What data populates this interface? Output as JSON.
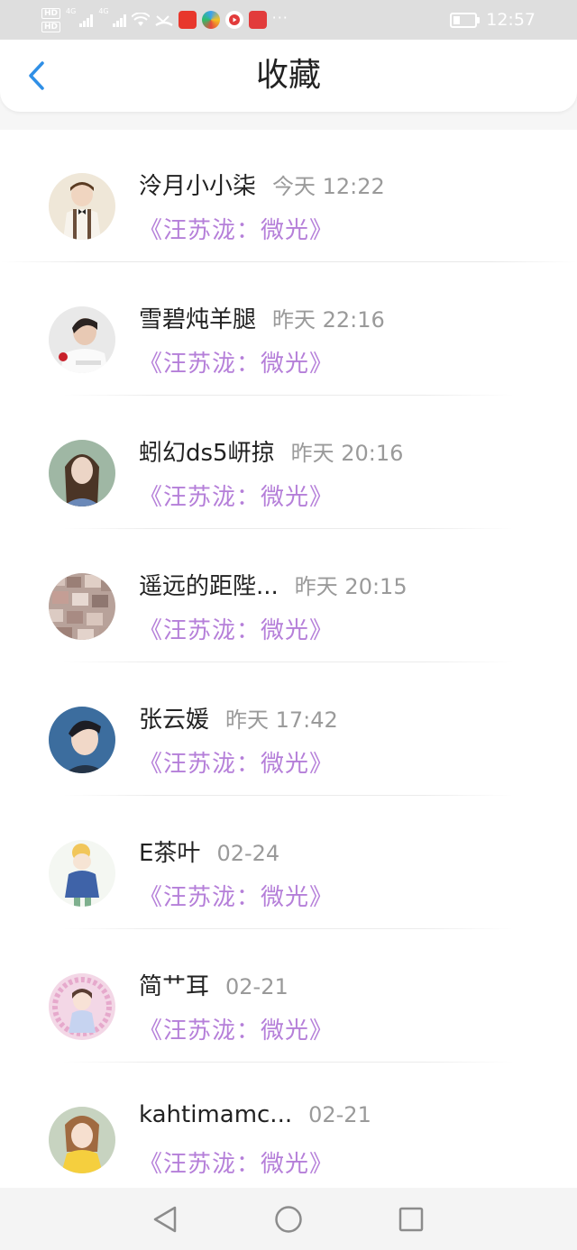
{
  "status_bar": {
    "hd_1": "HD",
    "hd_2": "HD",
    "net_1": "4G",
    "net_2": "4G",
    "time": "12:57",
    "battery_level": 0.3,
    "more": "···"
  },
  "header": {
    "title": "收藏",
    "back_icon": "chevron-left-icon",
    "accent_color": "#2f8fe6"
  },
  "favorites": [
    {
      "name": "泠月小小柒",
      "time": "今天 12:22",
      "book": "《汪苏泷：微光》"
    },
    {
      "name": "雪碧炖羊腿",
      "time": "昨天 22:16",
      "book": "《汪苏泷：微光》"
    },
    {
      "name": "蚓幻ds5岍掠",
      "time": "昨天 20:16",
      "book": "《汪苏泷：微光》"
    },
    {
      "name": "遥远的距陛...",
      "time": "昨天 20:15",
      "book": "《汪苏泷：微光》"
    },
    {
      "name": "张云媛",
      "time": "昨天 17:42",
      "book": "《汪苏泷：微光》"
    },
    {
      "name": "E茶叶",
      "time": "02-24",
      "book": "《汪苏泷：微光》"
    },
    {
      "name": "简艹耳",
      "time": "02-21",
      "book": "《汪苏泷：微光》"
    },
    {
      "name": "kahtimamc...",
      "time": "02-21",
      "book": "《汪苏泷：微光》"
    }
  ],
  "colors": {
    "book_title": "#b57fd9",
    "name": "#222222",
    "time": "#9a9a9a"
  },
  "nav": {
    "back_icon": "triangle-back-icon",
    "home_icon": "circle-home-icon",
    "recents_icon": "square-recents-icon"
  }
}
